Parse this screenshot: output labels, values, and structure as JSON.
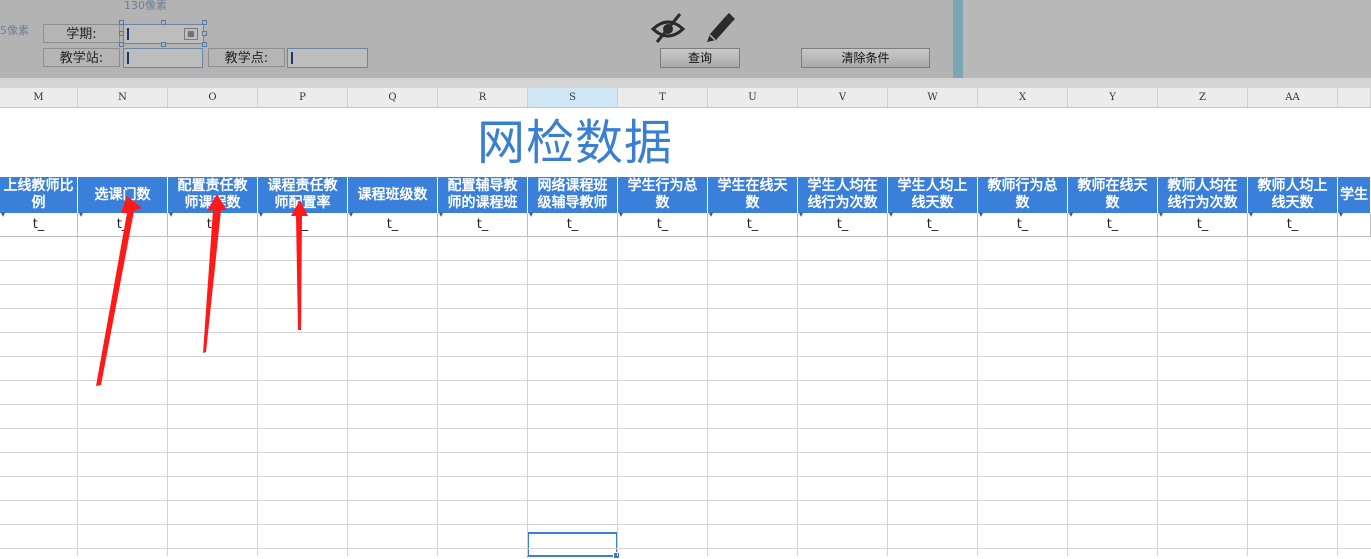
{
  "panel": {
    "px_note_top": "130像素",
    "px_note_left": "5像素",
    "term_label": "学期:",
    "term_value": "",
    "station_label": "教学站:",
    "station_value": "",
    "point_label": "教学点:",
    "point_value": "",
    "query_button": "查询",
    "clear_button": "清除条件",
    "icons": [
      "eye-slash-icon",
      "pencil-icon",
      "calendar-icon"
    ]
  },
  "column_letters": [
    "M",
    "N",
    "O",
    "P",
    "Q",
    "R",
    "S",
    "T",
    "U",
    "V",
    "W",
    "X",
    "Y",
    "Z",
    "AA"
  ],
  "active_column": "S",
  "report_title": "网检数据",
  "header_color": "#3a7fd9",
  "title_color": "#3a7fd0",
  "headers": [
    [
      "上线教师比",
      "例"
    ],
    [
      "选课门数"
    ],
    [
      "配置责任教",
      "师课程数"
    ],
    [
      "课程责任教",
      "师配置率"
    ],
    [
      "课程班级数"
    ],
    [
      "配置辅导教",
      "师的课程班"
    ],
    [
      "网络课程班",
      "级辅导教师"
    ],
    [
      "学生行为总",
      "数"
    ],
    [
      "学生在线天",
      "数"
    ],
    [
      "学生人均在",
      "线行为次数"
    ],
    [
      "学生人均上",
      "线天数"
    ],
    [
      "教师行为总",
      "数"
    ],
    [
      "教师在线天",
      "数"
    ],
    [
      "教师人均在",
      "线行为次数"
    ],
    [
      "教师人均上",
      "线天数"
    ],
    [
      "学生"
    ]
  ],
  "field_values": [
    "t_",
    "t_",
    "t_",
    "t_",
    "t_",
    "t_",
    "t_",
    "t_",
    "t_",
    "t_",
    "t_",
    "t_",
    "t_",
    "t_",
    "t_",
    ""
  ],
  "annotation_color": "#ff1a1a"
}
